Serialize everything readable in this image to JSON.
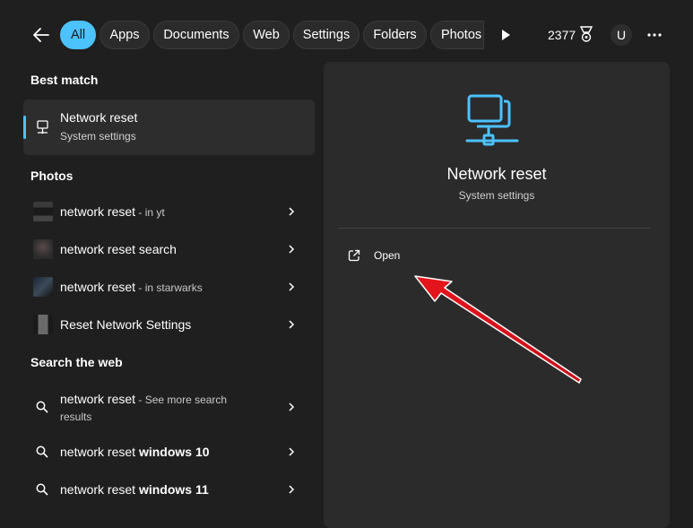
{
  "filters": {
    "tabs": [
      {
        "label": "All",
        "active": true
      },
      {
        "label": "Apps"
      },
      {
        "label": "Documents"
      },
      {
        "label": "Web"
      },
      {
        "label": "Settings"
      },
      {
        "label": "Folders"
      },
      {
        "label": "Photos"
      }
    ],
    "points": "2377",
    "avatar_initial": "U"
  },
  "sections": {
    "best_match": "Best match",
    "photos": "Photos",
    "search_web": "Search the web"
  },
  "best_match": {
    "title": "Network reset",
    "subtitle": "System settings"
  },
  "photos": [
    {
      "name": "network reset",
      "suffix": " - in yt"
    },
    {
      "name": "network reset search",
      "suffix": ""
    },
    {
      "name": "network reset",
      "suffix": " - in starwarks"
    },
    {
      "name": "Reset Network Settings",
      "suffix": ""
    }
  ],
  "web": [
    {
      "query": "network reset",
      "suffix": " - See more search",
      "suffix2": "results"
    },
    {
      "query": "network reset ",
      "bold": "windows 10"
    },
    {
      "query": "network reset ",
      "bold": "windows 11"
    }
  ],
  "detail": {
    "title": "Network reset",
    "subtitle": "System settings",
    "open_label": "Open"
  },
  "colors": {
    "accent": "#4cc2ff",
    "annotation_arrow": "#e8141c"
  },
  "icons": {
    "back": "arrow-left-icon",
    "play": "play-icon",
    "medal": "medal-icon",
    "more": "more-icon",
    "network": "network-icon",
    "search": "search-icon",
    "chevron": "chevron-right-icon",
    "open": "open-external-icon"
  }
}
